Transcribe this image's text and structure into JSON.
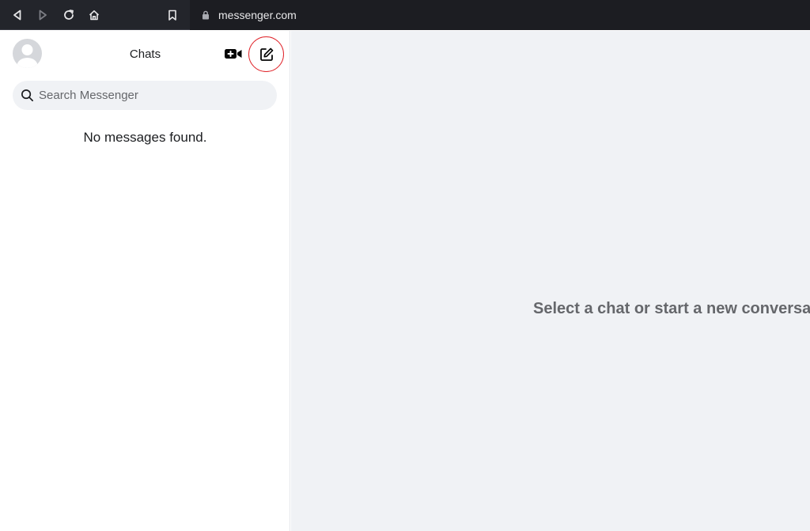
{
  "browser": {
    "url": "messenger.com",
    "icons": [
      "back-icon",
      "forward-icon",
      "reload-icon",
      "home-icon",
      "bookmark-icon",
      "lock-icon"
    ]
  },
  "sidebar": {
    "title": "Chats",
    "search": {
      "placeholder": "Search Messenger",
      "value": ""
    },
    "empty_message": "No messages found.",
    "icons": [
      "avatar",
      "new-video-call-icon",
      "compose-icon",
      "search-icon"
    ]
  },
  "main": {
    "prompt": "Select a chat or start a new conversation"
  },
  "colors": {
    "browser_bar": "#23252b",
    "url_box": "#1c1d22",
    "main_bg": "#f0f2f5",
    "compose_highlight": "#e0242a",
    "prompt_text": "#65676b"
  }
}
